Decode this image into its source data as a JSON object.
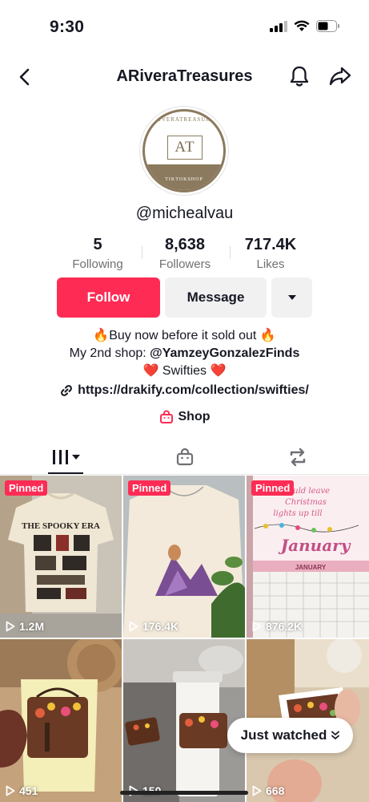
{
  "status_bar": {
    "time": "9:30"
  },
  "nav": {
    "title": "ARiveraTreasures"
  },
  "avatar": {
    "top_text": "ARIVERATREASURES",
    "monogram": "AT",
    "bottom_text": "TIKTOKSHOP"
  },
  "profile": {
    "username": "@michealvau"
  },
  "stats": [
    {
      "value": "5",
      "label": "Following"
    },
    {
      "value": "8,638",
      "label": "Followers"
    },
    {
      "value": "717.4K",
      "label": "Likes"
    }
  ],
  "buttons": {
    "follow": "Follow",
    "message": "Message"
  },
  "bio": {
    "line1": "🔥Buy now before it sold out 🔥",
    "line2_prefix": "My 2nd shop: ",
    "line2_handle": "@YamzeyGonzalezFinds",
    "line3": "❤️ Swifties ❤️"
  },
  "link": {
    "url": "https://drakify.com/collection/swifties/"
  },
  "shop": {
    "label": "Shop"
  },
  "colors": {
    "accent": "#fe2c55",
    "brand_brown": "#8b7a5e"
  },
  "videos": [
    {
      "pinned": "Pinned",
      "views": "1.2M"
    },
    {
      "pinned": "Pinned",
      "views": "176.4K"
    },
    {
      "pinned": "Pinned",
      "views": "876.2K"
    },
    {
      "pinned": "",
      "views": "451"
    },
    {
      "pinned": "",
      "views": "150"
    },
    {
      "pinned": "",
      "views": "668"
    }
  ],
  "video_thumbs": {
    "v1_title": "THE SPOOKY ERA",
    "v3_text1": "We could leave",
    "v3_text2": "Christmas",
    "v3_text3": "lights up till",
    "v3_text4": "January",
    "v3_month": "JANUARY"
  },
  "just_watched": {
    "label": "Just watched"
  }
}
